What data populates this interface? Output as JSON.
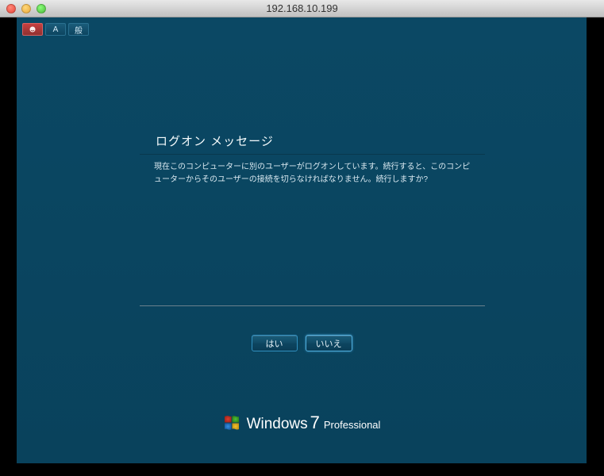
{
  "window": {
    "title": "192.168.10.199"
  },
  "ime": {
    "buttons": [
      {
        "type": "icon"
      },
      {
        "type": "text",
        "label": "A"
      },
      {
        "type": "text",
        "label": "般"
      }
    ]
  },
  "dialog": {
    "title": "ログオン メッセージ",
    "body": "現在このコンピューターに別のユーザーがログオンしています。続行すると、このコンピューターからそのユーザーの接続を切らなければなりません。続行しますか?",
    "yes_label": "はい",
    "no_label": "いいえ"
  },
  "branding": {
    "windows": "Windows",
    "version": "7",
    "edition": "Professional"
  }
}
